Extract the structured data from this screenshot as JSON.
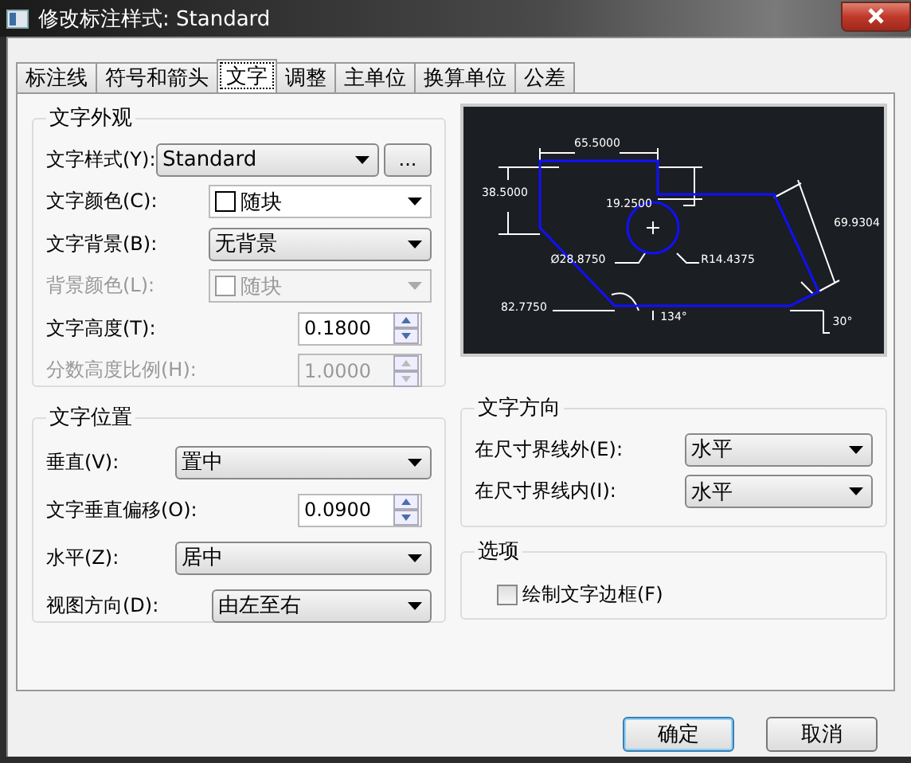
{
  "window": {
    "title": "修改标注样式: Standard"
  },
  "tabs": [
    {
      "label": "标注线",
      "selected": false
    },
    {
      "label": "符号和箭头",
      "selected": false
    },
    {
      "label": "文字",
      "selected": true
    },
    {
      "label": "调整",
      "selected": false
    },
    {
      "label": "主单位",
      "selected": false
    },
    {
      "label": "换算单位",
      "selected": false
    },
    {
      "label": "公差",
      "selected": false
    }
  ],
  "text_appearance": {
    "title": "文字外观",
    "rows": [
      {
        "kind": "select_button",
        "label": "文字样式(Y):",
        "value": "Standard",
        "button": "...",
        "disabled": false
      },
      {
        "kind": "color",
        "label": "文字颜色(C):",
        "value": "随块",
        "disabled": false
      },
      {
        "kind": "select",
        "label": "文字背景(B):",
        "value": "无背景",
        "disabled": false
      },
      {
        "kind": "color",
        "label": "背景颜色(L):",
        "value": "随块",
        "disabled": true
      },
      {
        "kind": "spinner",
        "label": "文字高度(T):",
        "value": "0.1800",
        "disabled": false
      },
      {
        "kind": "spinner",
        "label": "分数高度比例(H):",
        "value": "1.0000",
        "disabled": true
      }
    ]
  },
  "text_placement": {
    "title": "文字位置",
    "rows": [
      {
        "kind": "select",
        "label": "垂直(V):",
        "value": "置中",
        "disabled": false
      },
      {
        "kind": "spinner",
        "label": "文字垂直偏移(O):",
        "value": "0.0900",
        "disabled": false
      },
      {
        "kind": "select",
        "label": "水平(Z):",
        "value": "居中",
        "disabled": false
      },
      {
        "kind": "select",
        "label": "视图方向(D):",
        "value": "由左至右",
        "disabled": false
      }
    ]
  },
  "preview": {
    "labels": [
      "65.5000",
      "38.5000",
      "19.2500",
      "Ø28.8750",
      "R14.4375",
      "82.7750",
      "134°",
      "69.9304",
      "30°"
    ]
  },
  "text_alignment": {
    "title": "文字方向",
    "rows": [
      {
        "kind": "select",
        "label": "在尺寸界线外(E):",
        "value": "水平",
        "disabled": false
      },
      {
        "kind": "select",
        "label": "在尺寸界线内(I):",
        "value": "水平",
        "disabled": false
      }
    ]
  },
  "options": {
    "title": "选项",
    "checkbox": {
      "label": "绘制文字边框(F)",
      "checked": false
    }
  },
  "buttons": [
    "确定",
    "取消"
  ]
}
